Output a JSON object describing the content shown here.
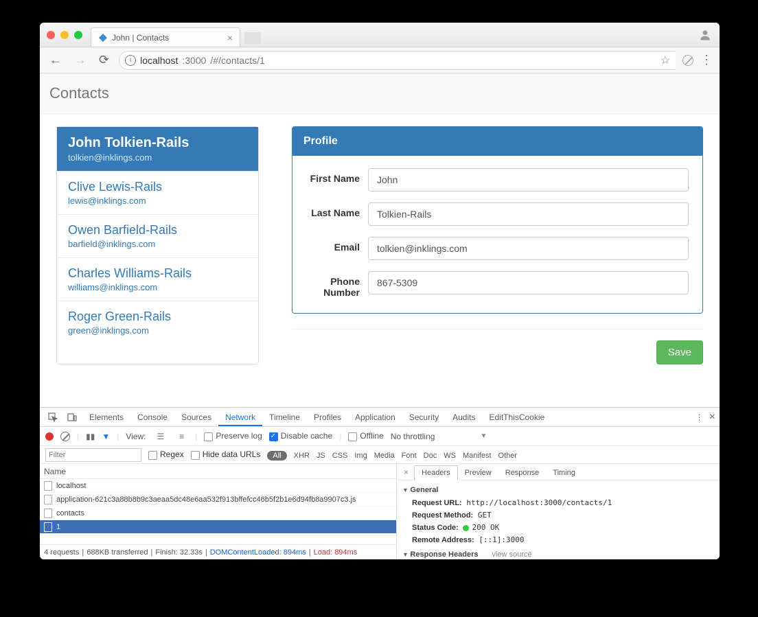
{
  "browser": {
    "tab_title": "John | Contacts",
    "url_host": "localhost",
    "url_port": ":3000",
    "url_path": "/#/contacts/1"
  },
  "page": {
    "header": "Contacts"
  },
  "contacts": [
    {
      "name": "John Tolkien-Rails",
      "email": "tolkien@inklings.com",
      "active": true
    },
    {
      "name": "Clive Lewis-Rails",
      "email": "lewis@inklings.com",
      "active": false
    },
    {
      "name": "Owen Barfield-Rails",
      "email": "barfield@inklings.com",
      "active": false
    },
    {
      "name": "Charles Williams-Rails",
      "email": "williams@inklings.com",
      "active": false
    },
    {
      "name": "Roger Green-Rails",
      "email": "green@inklings.com",
      "active": false
    }
  ],
  "profile": {
    "panel_title": "Profile",
    "labels": {
      "first_name": "First Name",
      "last_name": "Last Name",
      "email": "Email",
      "phone": "Phone Number"
    },
    "values": {
      "first_name": "John",
      "last_name": "Tolkien-Rails",
      "email": "tolkien@inklings.com",
      "phone": "867-5309"
    },
    "save_label": "Save"
  },
  "devtools": {
    "tabs": [
      "Elements",
      "Console",
      "Sources",
      "Network",
      "Timeline",
      "Profiles",
      "Application",
      "Security",
      "Audits",
      "EditThisCookie"
    ],
    "active_tab": "Network",
    "toolbar": {
      "view_label": "View:",
      "preserve_log": "Preserve log",
      "disable_cache": "Disable cache",
      "offline": "Offline",
      "throttling": "No throttling"
    },
    "filter": {
      "placeholder": "Filter",
      "regex": "Regex",
      "hide_data_urls": "Hide data URLs",
      "types": [
        "All",
        "XHR",
        "JS",
        "CSS",
        "Img",
        "Media",
        "Font",
        "Doc",
        "WS",
        "Manifest",
        "Other"
      ],
      "active_type": "All"
    },
    "requests": {
      "column": "Name",
      "rows": [
        {
          "name": "localhost",
          "selected": false
        },
        {
          "name": "application-621c3a88b8b9c3aeaa5dc48e6aa532f913bffefcc46b5f2b1e6d94fb8a9907c3.js",
          "selected": false
        },
        {
          "name": "contacts",
          "selected": false
        },
        {
          "name": "1",
          "selected": true
        }
      ]
    },
    "status_bar": {
      "requests": "4 requests",
      "transferred": "688KB transferred",
      "finish": "Finish: 32.33s",
      "dcl_label": "DOMContentLoaded: 894ms",
      "load_label": "Load: 894ms"
    },
    "detail": {
      "tabs": [
        "Headers",
        "Preview",
        "Response",
        "Timing"
      ],
      "active": "Headers",
      "general": {
        "title": "General",
        "request_url_label": "Request URL:",
        "request_url": "http://localhost:3000/contacts/1",
        "method_label": "Request Method:",
        "method": "GET",
        "status_label": "Status Code:",
        "status": "200 OK",
        "remote_label": "Remote Address:",
        "remote": "[::1]:3000"
      },
      "response_headers": {
        "title": "Response Headers",
        "view_source": "view source"
      }
    }
  }
}
